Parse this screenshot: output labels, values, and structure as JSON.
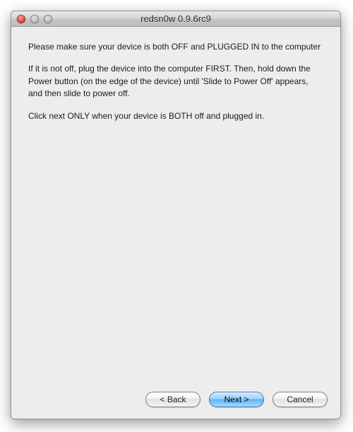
{
  "window": {
    "title": "redsn0w 0.9.6rc9"
  },
  "body": {
    "p1": "Please make sure your device is both OFF and PLUGGED IN to the computer",
    "p2": "If it is not off, plug the device into the computer FIRST. Then, hold down the Power button (on the edge of the device) until 'Slide to Power Off' appears, and then slide to power off.",
    "p3": "Click next ONLY when your device is BOTH off and plugged in."
  },
  "buttons": {
    "back": "< Back",
    "next": "Next >",
    "cancel": "Cancel"
  }
}
